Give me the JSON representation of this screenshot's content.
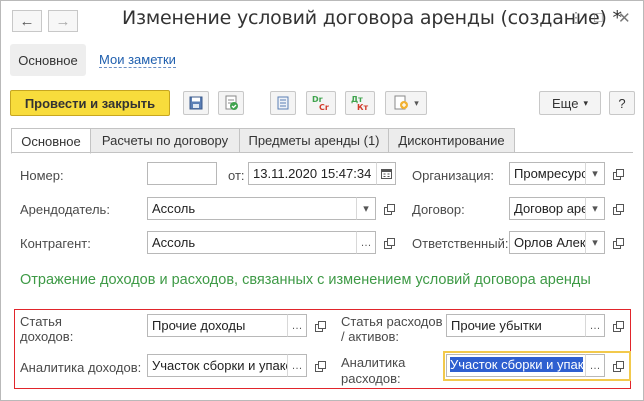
{
  "window": {
    "title": "Изменение условий договора аренды (создание) *"
  },
  "top_tabs": {
    "main": "Основное",
    "notes": "Мои заметки"
  },
  "toolbar": {
    "post_close": "Провести и закрыть",
    "more": "Еще",
    "help": "?"
  },
  "tabs": [
    "Основное",
    "Расчеты по договору",
    "Предметы аренды (1)",
    "Дисконтирование"
  ],
  "form": {
    "number_label": "Номер:",
    "number_value": "",
    "date_from_label": "от:",
    "date_value": "13.11.2020 15:47:34",
    "org_label": "Организация:",
    "org_value": "Промресурс",
    "lessor_label": "Арендодатель:",
    "lessor_value": "Ассоль",
    "contract_label": "Договор:",
    "contract_value": "Договор аренды",
    "counterparty_label": "Контрагент:",
    "counterparty_value": "Ассоль",
    "responsible_label": "Ответственный:",
    "responsible_value": "Орлов Алексей"
  },
  "section": {
    "title": "Отражение доходов и расходов, связанных с изменением условий договора аренды",
    "income_item_label_1": "Статья",
    "income_item_label_2": "доходов:",
    "income_item_value": "Прочие доходы",
    "expense_item_label_1": "Статья расходов",
    "expense_item_label_2": "/ активов:",
    "expense_item_value": "Прочие убытки",
    "income_analytics_label": "Аналитика доходов:",
    "income_analytics_value": "Участок сборки и упаковки",
    "expense_analytics_label_1": "Аналитика",
    "expense_analytics_label_2": "расходов:",
    "expense_analytics_value": "Участок сборки и упак"
  },
  "colors": {
    "accent_yellow": "#f8dc3c",
    "section_green": "#3e9a46",
    "link_blue": "#1f5fae",
    "highlight_red": "#e1252b",
    "focus_yellow": "#f2c94c"
  }
}
